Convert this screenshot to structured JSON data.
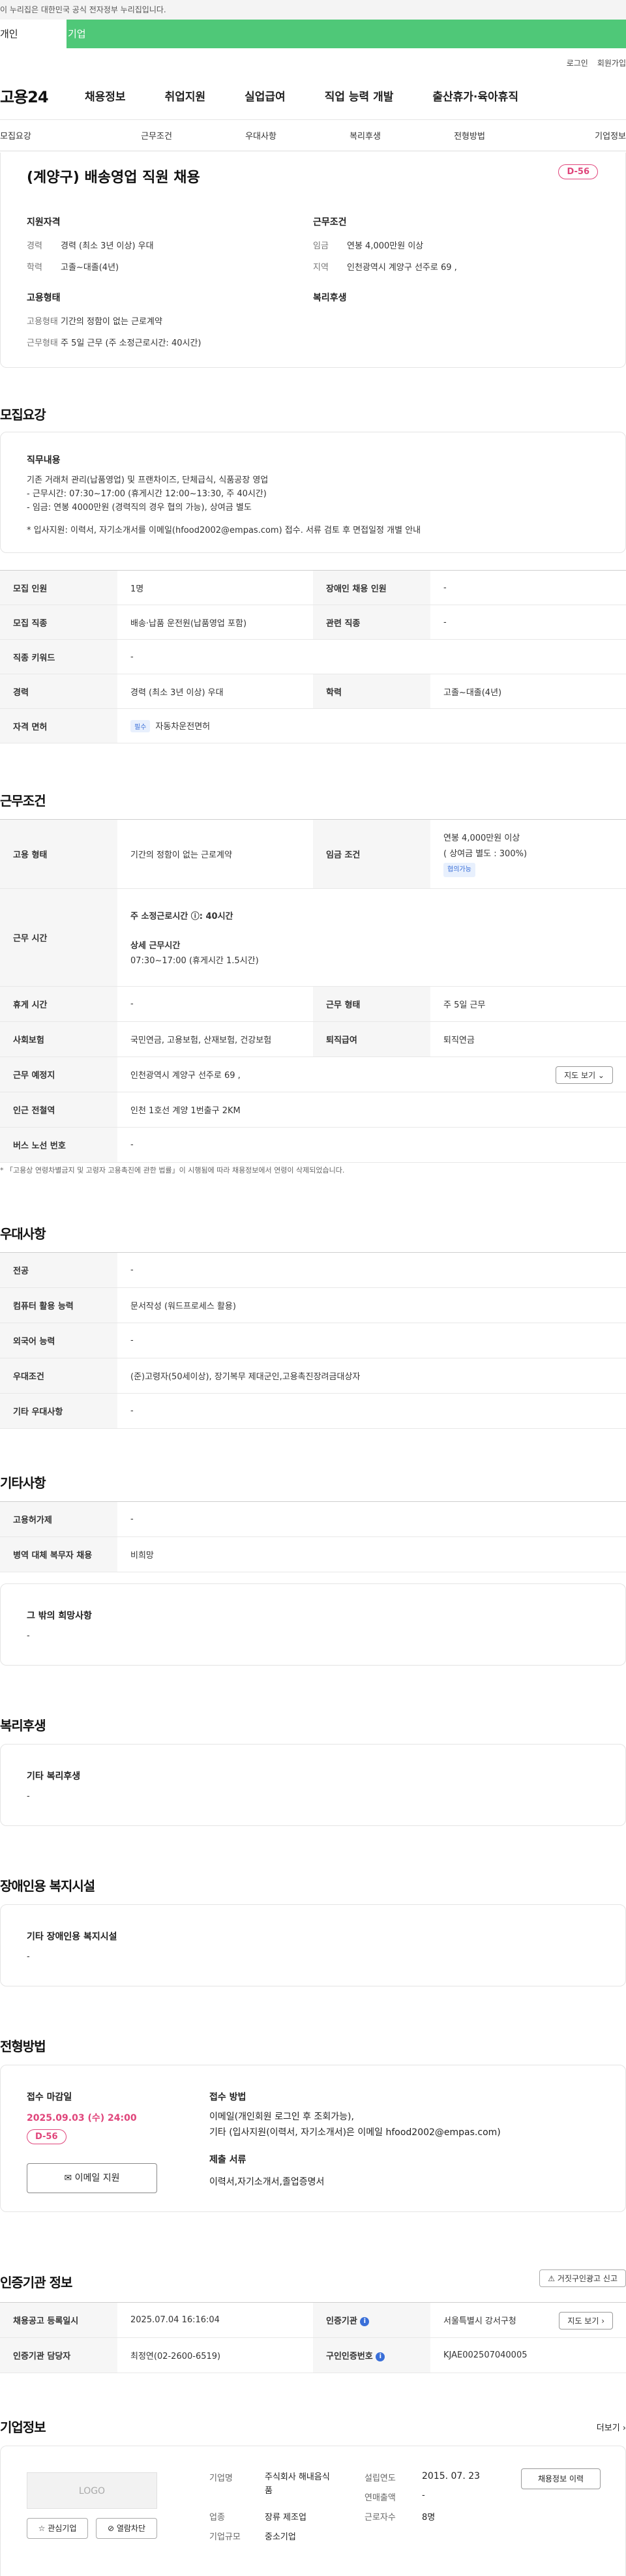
{
  "gov_banner": "이 누리집은 대한민국 공식 전자정부 누리집입니다.",
  "user_tabs": [
    "개인",
    "기업"
  ],
  "util": [
    "로그인",
    "회원가입"
  ],
  "logo": "고용24",
  "gnb": [
    "채용정보",
    "취업지원",
    "실업급여",
    "직업 능력 개발",
    "출산휴가·육아휴직"
  ],
  "sub_tabs": [
    "모집요강",
    "근무조건",
    "우대사항",
    "복리후생",
    "전형방법",
    "기업정보"
  ],
  "summary": {
    "title": "(계양구) 배송영업 직원 채용",
    "dday": "D-56",
    "qual_title": "지원자격",
    "career_k": "경력",
    "career_v": "경력 (최소 3년 이상) 우대",
    "edu_k": "학력",
    "edu_v": "고졸~대졸(4년)",
    "emp_title": "고용형태",
    "emp_k": "고용형태",
    "emp_v": "기간의 정함이 없는 근로계약",
    "form_k": "근무형태",
    "form_v": "주 5일 근무 (주 소정근로시간: 40시간)",
    "cond_title": "근무조건",
    "wage_k": "임금",
    "wage_v": "연봉 4,000만원 이상",
    "region_k": "지역",
    "region_v": "인천광역시 계양구 선주로 69 ,",
    "welfare_title": "복리후생"
  },
  "recruit": {
    "title": "모집요강",
    "job_h": "직무내용",
    "job_lines": [
      "기존 거래처 관리(납품영업) 및 프랜차이즈, 단체급식, 식품공장 영업",
      "- 근무시간: 07:30~17:00 (휴게시간 12:00~13:30, 주 40시간)",
      "- 임금: 연봉 4000만원 (경력직의 경우 협의 가능), 상여금 별도",
      "",
      "* 입사지원: 이력서, 자기소개서를 이메일(hfood2002@empas.com) 접수. 서류 검토 후 면접일정 개별 안내"
    ],
    "rows": [
      [
        "모집 인원",
        "1명",
        "장애인 채용 인원",
        "-"
      ],
      [
        "모집 직종",
        "배송·납품 운전원(납품영업 포함)",
        "관련 직종",
        "-"
      ],
      [
        "직종 키워드",
        "-"
      ],
      [
        "경력",
        "경력 (최소 3년 이상) 우대",
        "학력",
        "고졸~대졸(4년)"
      ]
    ],
    "license_k": "자격 면허",
    "license_tag": "필수",
    "license_v": "자동차운전면허"
  },
  "work": {
    "title": "근무조건",
    "type_k": "고용 형태",
    "type_v": "기간의 정함이 없는 근로계약",
    "wage_k": "임금 조건",
    "wage_v1": "연봉 4,000만원 이상",
    "wage_v2": "( 상여금 별도 : 300%)",
    "wage_tag": "협의가능",
    "hours_k": "근무 시간",
    "hours_1": "주 소정근로시간 ⓘ: 40시간",
    "hours_2_label": "상세 근무시간",
    "hours_2": "07:30~17:00 (휴게시간 1.5시간)",
    "rest_k": "휴게 시간",
    "rest_v": "-",
    "form_k": "근무 형태",
    "form_v": "주 5일 근무",
    "ins_k": "사회보험",
    "ins_v": "국민연금, 고용보험, 산재보험, 건강보험",
    "ret_k": "퇴직급여",
    "ret_v": "퇴직연금",
    "place_k": "근무 예정지",
    "place_v": "인천광역시 계양구 선주로 69 ,",
    "map_btn": "지도 보기 ⌄",
    "subway_k": "인근 전철역",
    "subway_v": "인천 1호선 계양 1번출구 2KM",
    "bus_k": "버스 노선 번호",
    "bus_v": "-",
    "note": "* 「고용상 연령차별금지 및 고령자 고용촉진에 관한 법률」이 시행됨에 따라 채용정보에서 연령이 삭제되었습니다."
  },
  "pref": {
    "title": "우대사항",
    "rows": [
      [
        "전공",
        "-"
      ],
      [
        "컴퓨터 활용 능력",
        "문서작성 (워드프로세스 활용)"
      ],
      [
        "외국어 능력",
        "-"
      ],
      [
        "우대조건",
        "(준)고령자(50세이상), 장기복무 제대군인,고용촉진장려금대상자"
      ],
      [
        "기타 우대사항",
        "-"
      ]
    ]
  },
  "etc": {
    "title": "기타사항",
    "rows": [
      [
        "고용허가제",
        "-"
      ],
      [
        "병역 대체 복무자 채용",
        "비희망"
      ]
    ],
    "wish_h": "그 밖의 희망사항",
    "wish_v": "-"
  },
  "welfare": {
    "title": "복리후생",
    "h": "기타 복리후생",
    "v": "-"
  },
  "disab": {
    "title": "장애인용 복지시설",
    "h": "기타 장애인용 복지시설",
    "v": "-"
  },
  "process": {
    "title": "전형방법",
    "deadline_h": "접수 마감일",
    "deadline_v": "2025.09.03 (수) 24:00",
    "dday": "D-56",
    "email_btn": "✉ 이메일 지원",
    "method_h": "접수 방법",
    "method_v1": "이메일(개인회원 로그인 후 조회가능),",
    "method_v2": "기타 (입사지원(이력서, 자기소개서)은 이메일 hfood2002@empas.com)",
    "docs_h": "제출 서류",
    "docs_v": "이력서,자기소개서,졸업증명서"
  },
  "agency": {
    "title": "인증기관 정보",
    "report_btn": "⚠ 거짓구인광고 신고",
    "reg_k": "채용공고 등록일시",
    "reg_v": "2025.07.04 16:16:04",
    "org_k": "인증기관",
    "org_v": "서울특별시 강서구청",
    "map_btn": "지도 보기 ›",
    "staff_k": "인증기관 담당자",
    "staff_v": "최정연(02-2600-6519)",
    "num_k": "구인인증번호",
    "num_v": "KJAE002507040005"
  },
  "company": {
    "title": "기업정보",
    "more": "더보기 ›",
    "logo": "LOGO",
    "fav_btn": "☆ 관심기업",
    "block_btn": "⊘ 열람차단",
    "name_k": "기업명",
    "name_v": "주식회사 해내음식품",
    "ind_k": "업종",
    "ind_v": "장류 제조업",
    "size_k": "기업규모",
    "size_v": "중소기업",
    "est_k": "설립연도",
    "est_v": "2015. 07. 23",
    "sales_k": "연매출액",
    "sales_v": "-",
    "emp_k": "근로자수",
    "emp_v": "8명",
    "history_btn": "채용정보 이력"
  }
}
